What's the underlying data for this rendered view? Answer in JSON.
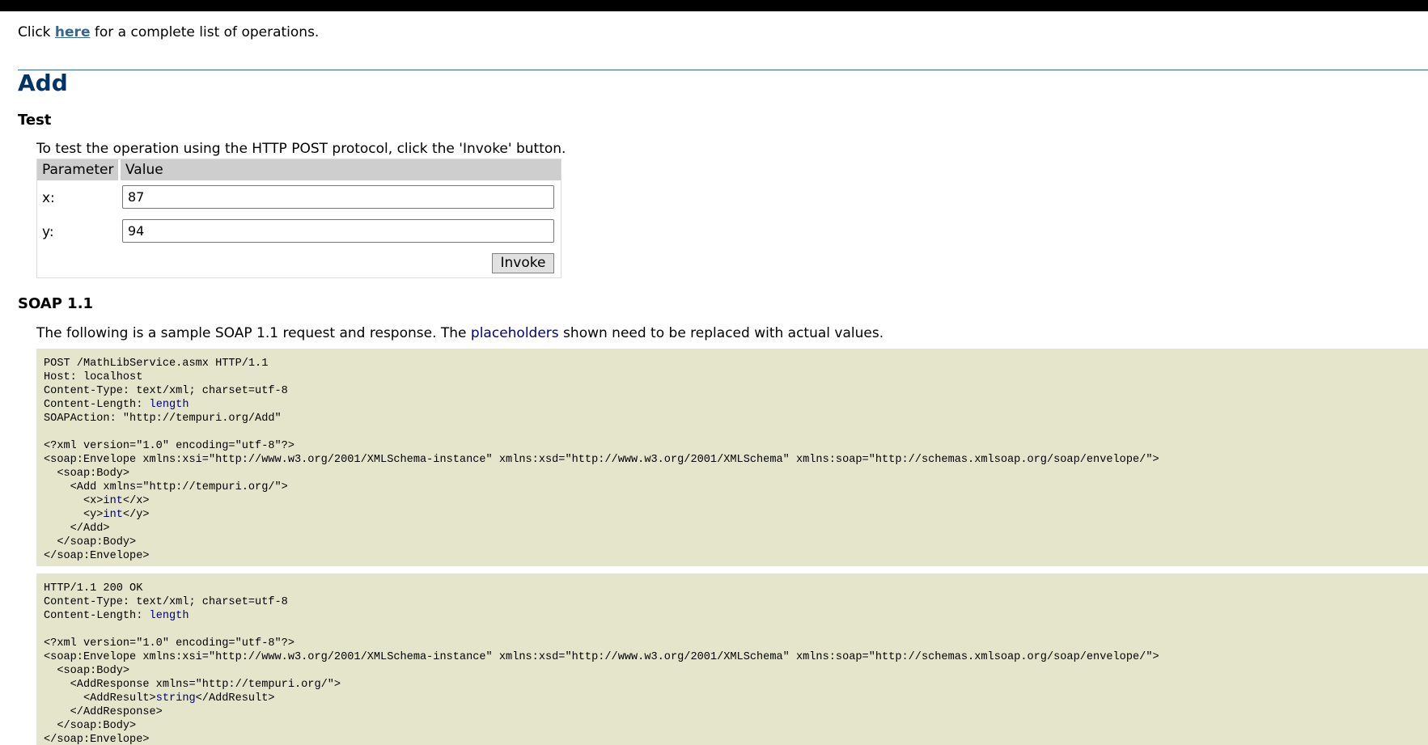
{
  "intro": {
    "prefix": "Click ",
    "link": "here",
    "suffix": " for a complete list of operations."
  },
  "operation": {
    "name": "Add"
  },
  "test": {
    "heading": "Test",
    "description": "To test the operation using the HTTP POST protocol, click the 'Invoke' button.",
    "columns": {
      "parameter": "Parameter",
      "value": "Value"
    },
    "params": [
      {
        "label": "x:",
        "value": "87"
      },
      {
        "label": "y:",
        "value": "94"
      }
    ],
    "invoke_label": "Invoke"
  },
  "soap11": {
    "heading": "SOAP 1.1",
    "description_prefix": "The following is a sample SOAP 1.1 request and response. The ",
    "placeholders_word": "placeholders",
    "description_suffix": " shown need to be replaced with actual values.",
    "request": {
      "request_line": "POST /MathLibService.asmx HTTP/1.1",
      "host_line": "Host: localhost",
      "content_type_line": "Content-Type: text/xml; charset=utf-8",
      "content_length_prefix": "Content-Length: ",
      "content_length_placeholder": "length",
      "soapaction_line": "SOAPAction: \"http://tempuri.org/Add\"",
      "xml_declaration": "<?xml version=\"1.0\" encoding=\"utf-8\"?>",
      "envelope_open": "<soap:Envelope xmlns:xsi=\"http://www.w3.org/2001/XMLSchema-instance\" xmlns:xsd=\"http://www.w3.org/2001/XMLSchema\" xmlns:soap=\"http://schemas.xmlsoap.org/soap/envelope/\">",
      "body_open": "  <soap:Body>",
      "add_open": "    <Add xmlns=\"http://tempuri.org/\">",
      "x_open": "      <x>",
      "x_placeholder": "int",
      "x_close": "</x>",
      "y_open": "      <y>",
      "y_placeholder": "int",
      "y_close": "</y>",
      "add_close": "    </Add>",
      "body_close": "  </soap:Body>",
      "envelope_close": "</soap:Envelope>"
    },
    "response": {
      "status_line": "HTTP/1.1 200 OK",
      "content_type_line": "Content-Type: text/xml; charset=utf-8",
      "content_length_prefix": "Content-Length: ",
      "content_length_placeholder": "length",
      "xml_declaration": "<?xml version=\"1.0\" encoding=\"utf-8\"?>",
      "envelope_open": "<soap:Envelope xmlns:xsi=\"http://www.w3.org/2001/XMLSchema-instance\" xmlns:xsd=\"http://www.w3.org/2001/XMLSchema\" xmlns:soap=\"http://schemas.xmlsoap.org/soap/envelope/\">",
      "body_open": "  <soap:Body>",
      "response_open": "    <AddResponse xmlns=\"http://tempuri.org/\">",
      "result_open": "      <AddResult>",
      "result_placeholder": "string",
      "result_close": "</AddResult>",
      "response_close": "    </AddResponse>",
      "body_close": "  </soap:Body>",
      "envelope_close": "</soap:Envelope>"
    }
  },
  "colors": {
    "link": "#336699",
    "title": "#003366",
    "placeholder": "#000080",
    "code_background": "#e5e5cc",
    "table_header": "#cecece"
  }
}
